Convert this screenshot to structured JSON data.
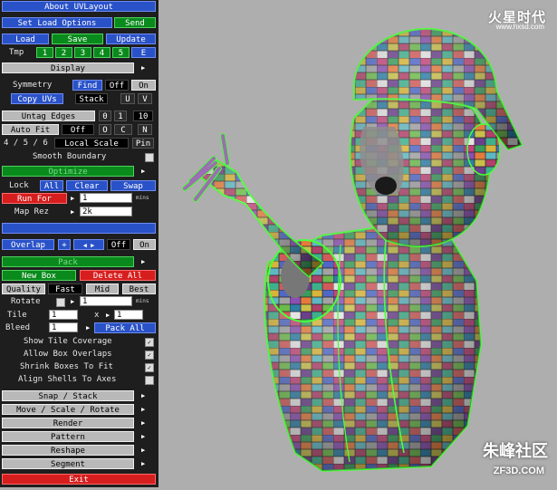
{
  "panel": {
    "title": "About UVLayout",
    "set_load_options": "Set Load Options",
    "send": "Send",
    "load": "Load",
    "save": "Save",
    "update": "Update",
    "tmp_label": "Tmp",
    "tmp_slots": [
      "1",
      "2",
      "3",
      "4",
      "5",
      "E"
    ],
    "display": "Display",
    "symmetry": "Symmetry",
    "find": "Find",
    "off": "Off",
    "on": "On",
    "copy_uvs": "Copy UVs",
    "stack": "Stack",
    "u": "U",
    "v": "V",
    "untag_edges": "Untag Edges",
    "n0": "0",
    "n1": "1",
    "n10": "10",
    "auto_fit": "Auto Fit",
    "auto_fit_value": "Off",
    "o": "O",
    "c": "C",
    "n": "N",
    "nums_456": "4 / 5 / 6",
    "local_scale": "Local Scale",
    "pin": "Pin",
    "smooth_boundary": "Smooth Boundary",
    "optimize": "Optimize",
    "lock": "Lock",
    "all": "All",
    "clear": "Clear",
    "swap": "Swap",
    "run_for": "Run For",
    "run_for_value": "1",
    "mins": "mins",
    "map_rez": "Map Rez",
    "map_rez_value": "2k",
    "overlap": "Overlap",
    "plus": "+",
    "pack": "Pack",
    "new_box": "New Box",
    "delete_all": "Delete All",
    "quality": "Quality",
    "fast": "Fast",
    "mid": "Mid",
    "best": "Best",
    "rotate": "Rotate",
    "rotate_value": "1",
    "tile": "Tile",
    "tile_x": "1",
    "x": "x",
    "tile_y": "1",
    "bleed": "Bleed",
    "bleed_value": "1",
    "pack_all": "Pack All",
    "show_tile_coverage": "Show Tile Coverage",
    "allow_box_overlaps": "Allow Box Overlaps",
    "shrink_boxes_to_fit": "Shrink Boxes To Fit",
    "align_shells_to_axes": "Align Shells To Axes",
    "snap_stack": "Snap / Stack",
    "move_scale_rotate": "Move / Scale / Rotate",
    "render": "Render",
    "pattern": "Pattern",
    "reshape": "Reshape",
    "segment": "Segment",
    "exit": "Exit"
  },
  "watermarks": {
    "top_right": "火星时代",
    "top_right_sub": "www.hxsd.com",
    "bottom_right": "朱峰社区",
    "bottom_right_sub": "ZF3D.COM"
  },
  "colors": {
    "blue": "#2a52c8",
    "green": "#0a8a1c",
    "red": "#d61e1e",
    "gray": "#b9b9b9",
    "viewport_bg": "#aeaeae"
  },
  "icons": [
    "arrow-right-icon",
    "arrow-left-icon",
    "checkbox-icon",
    "uv-checker-model"
  ]
}
